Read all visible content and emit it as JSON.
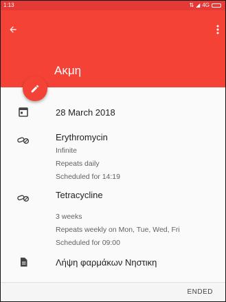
{
  "status_bar": {
    "time": "1:13",
    "network": "4G"
  },
  "header": {
    "title": "Ακμη",
    "color": "#f44336"
  },
  "details": {
    "date": "28 March 2018",
    "medications": [
      {
        "name": "Erythromycin",
        "lines": [
          "Infinite",
          "Repeats daily",
          "Scheduled for 14:19"
        ]
      },
      {
        "name": "Tetracycline",
        "lines": [
          "3 weeks",
          "Repeats weekly on Mon, Tue, Wed, Fri",
          "Scheduled for 09:00"
        ]
      }
    ],
    "notes": "Λήψη φαρμάκων Νηστικη"
  },
  "footer": {
    "ended_label": "ENDED"
  },
  "icons": {
    "back": "arrow-left-icon",
    "overflow": "more-vert-icon",
    "fab": "pencil-icon",
    "date": "calendar-icon",
    "medication": "pill-icon",
    "notes": "document-icon"
  }
}
